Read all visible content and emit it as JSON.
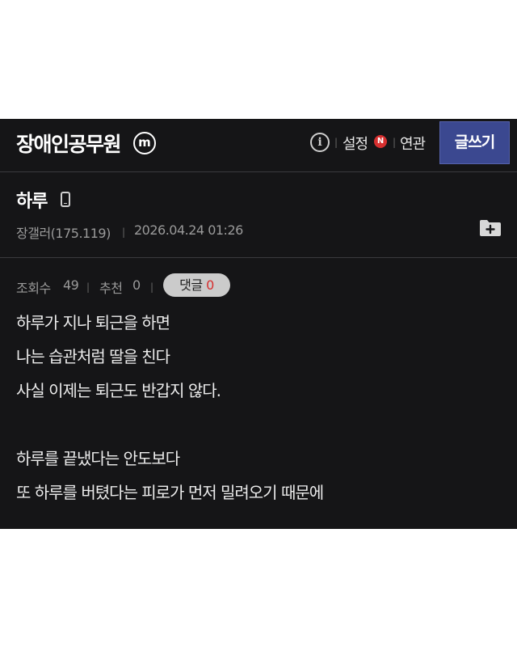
{
  "header": {
    "gallery_title": "장애인공무원",
    "minor_badge": "m",
    "info_icon": "info-icon",
    "settings_label": "설정",
    "new_badge": "N",
    "related_label": "연관",
    "write_button": "글쓰기"
  },
  "post": {
    "title": "하루",
    "author": "장갤러(175.119)",
    "datetime": "2026.04.24 01:26",
    "views_label": "조회수",
    "views": "49",
    "recommend_label": "추천",
    "recommend": "0",
    "comments_label": "댓글",
    "comments": "0",
    "body_lines": [
      "하루가 지나 퇴근을 하면",
      "나는 습관처럼 딸을 친다",
      "사실 이제는 퇴근도 반갑지 않다.",
      "",
      "하루를 끝냈다는 안도보다",
      "또 하루를 버텼다는 피로가 먼저 밀려오기 때문에"
    ]
  },
  "colors": {
    "background": "#151517",
    "write_button": "#3b4890",
    "new_badge": "#d62f2f",
    "comment_pill": "#cbcbcb"
  }
}
